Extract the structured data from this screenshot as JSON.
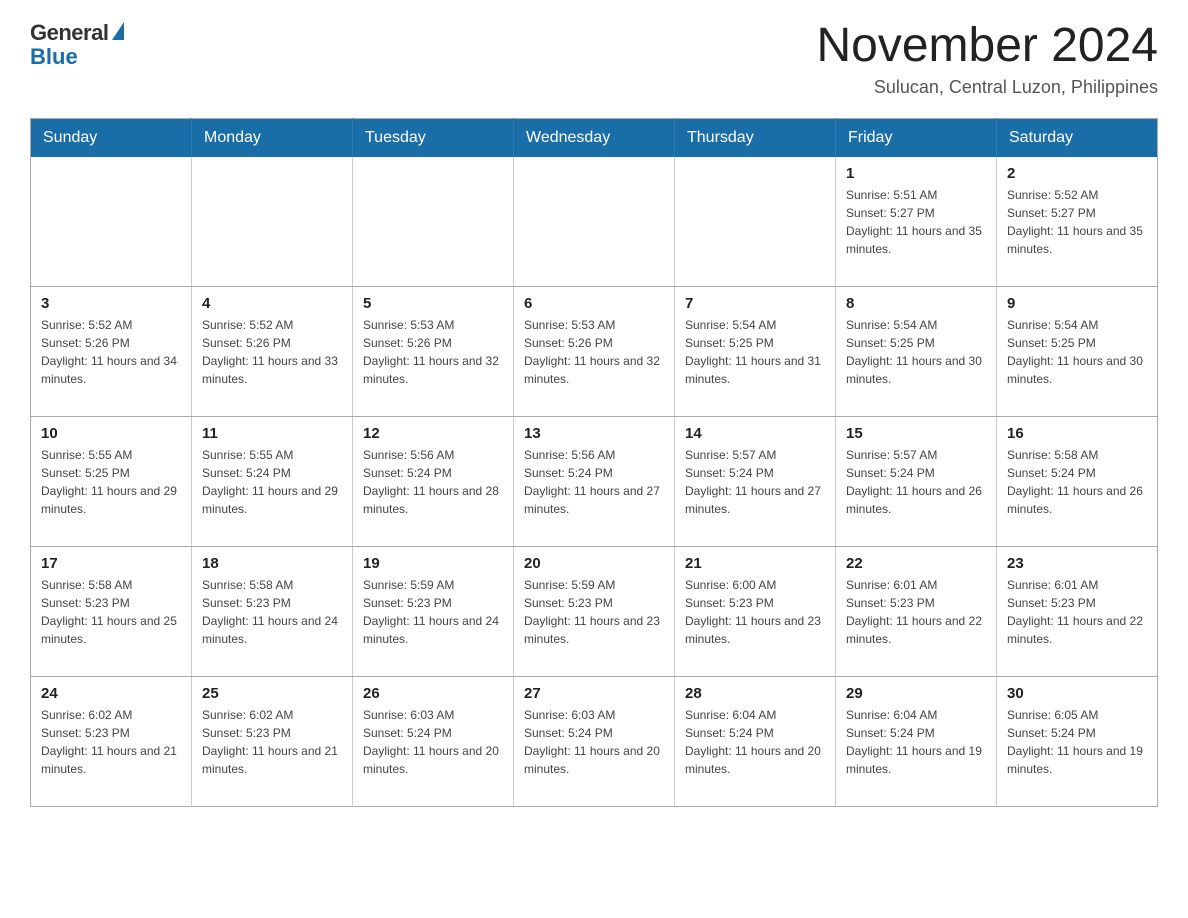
{
  "logo": {
    "general": "General",
    "blue": "Blue"
  },
  "title": "November 2024",
  "subtitle": "Sulucan, Central Luzon, Philippines",
  "weekdays": [
    "Sunday",
    "Monday",
    "Tuesday",
    "Wednesday",
    "Thursday",
    "Friday",
    "Saturday"
  ],
  "weeks": [
    [
      {
        "day": "",
        "info": ""
      },
      {
        "day": "",
        "info": ""
      },
      {
        "day": "",
        "info": ""
      },
      {
        "day": "",
        "info": ""
      },
      {
        "day": "",
        "info": ""
      },
      {
        "day": "1",
        "info": "Sunrise: 5:51 AM\nSunset: 5:27 PM\nDaylight: 11 hours and 35 minutes."
      },
      {
        "day": "2",
        "info": "Sunrise: 5:52 AM\nSunset: 5:27 PM\nDaylight: 11 hours and 35 minutes."
      }
    ],
    [
      {
        "day": "3",
        "info": "Sunrise: 5:52 AM\nSunset: 5:26 PM\nDaylight: 11 hours and 34 minutes."
      },
      {
        "day": "4",
        "info": "Sunrise: 5:52 AM\nSunset: 5:26 PM\nDaylight: 11 hours and 33 minutes."
      },
      {
        "day": "5",
        "info": "Sunrise: 5:53 AM\nSunset: 5:26 PM\nDaylight: 11 hours and 32 minutes."
      },
      {
        "day": "6",
        "info": "Sunrise: 5:53 AM\nSunset: 5:26 PM\nDaylight: 11 hours and 32 minutes."
      },
      {
        "day": "7",
        "info": "Sunrise: 5:54 AM\nSunset: 5:25 PM\nDaylight: 11 hours and 31 minutes."
      },
      {
        "day": "8",
        "info": "Sunrise: 5:54 AM\nSunset: 5:25 PM\nDaylight: 11 hours and 30 minutes."
      },
      {
        "day": "9",
        "info": "Sunrise: 5:54 AM\nSunset: 5:25 PM\nDaylight: 11 hours and 30 minutes."
      }
    ],
    [
      {
        "day": "10",
        "info": "Sunrise: 5:55 AM\nSunset: 5:25 PM\nDaylight: 11 hours and 29 minutes."
      },
      {
        "day": "11",
        "info": "Sunrise: 5:55 AM\nSunset: 5:24 PM\nDaylight: 11 hours and 29 minutes."
      },
      {
        "day": "12",
        "info": "Sunrise: 5:56 AM\nSunset: 5:24 PM\nDaylight: 11 hours and 28 minutes."
      },
      {
        "day": "13",
        "info": "Sunrise: 5:56 AM\nSunset: 5:24 PM\nDaylight: 11 hours and 27 minutes."
      },
      {
        "day": "14",
        "info": "Sunrise: 5:57 AM\nSunset: 5:24 PM\nDaylight: 11 hours and 27 minutes."
      },
      {
        "day": "15",
        "info": "Sunrise: 5:57 AM\nSunset: 5:24 PM\nDaylight: 11 hours and 26 minutes."
      },
      {
        "day": "16",
        "info": "Sunrise: 5:58 AM\nSunset: 5:24 PM\nDaylight: 11 hours and 26 minutes."
      }
    ],
    [
      {
        "day": "17",
        "info": "Sunrise: 5:58 AM\nSunset: 5:23 PM\nDaylight: 11 hours and 25 minutes."
      },
      {
        "day": "18",
        "info": "Sunrise: 5:58 AM\nSunset: 5:23 PM\nDaylight: 11 hours and 24 minutes."
      },
      {
        "day": "19",
        "info": "Sunrise: 5:59 AM\nSunset: 5:23 PM\nDaylight: 11 hours and 24 minutes."
      },
      {
        "day": "20",
        "info": "Sunrise: 5:59 AM\nSunset: 5:23 PM\nDaylight: 11 hours and 23 minutes."
      },
      {
        "day": "21",
        "info": "Sunrise: 6:00 AM\nSunset: 5:23 PM\nDaylight: 11 hours and 23 minutes."
      },
      {
        "day": "22",
        "info": "Sunrise: 6:01 AM\nSunset: 5:23 PM\nDaylight: 11 hours and 22 minutes."
      },
      {
        "day": "23",
        "info": "Sunrise: 6:01 AM\nSunset: 5:23 PM\nDaylight: 11 hours and 22 minutes."
      }
    ],
    [
      {
        "day": "24",
        "info": "Sunrise: 6:02 AM\nSunset: 5:23 PM\nDaylight: 11 hours and 21 minutes."
      },
      {
        "day": "25",
        "info": "Sunrise: 6:02 AM\nSunset: 5:23 PM\nDaylight: 11 hours and 21 minutes."
      },
      {
        "day": "26",
        "info": "Sunrise: 6:03 AM\nSunset: 5:24 PM\nDaylight: 11 hours and 20 minutes."
      },
      {
        "day": "27",
        "info": "Sunrise: 6:03 AM\nSunset: 5:24 PM\nDaylight: 11 hours and 20 minutes."
      },
      {
        "day": "28",
        "info": "Sunrise: 6:04 AM\nSunset: 5:24 PM\nDaylight: 11 hours and 20 minutes."
      },
      {
        "day": "29",
        "info": "Sunrise: 6:04 AM\nSunset: 5:24 PM\nDaylight: 11 hours and 19 minutes."
      },
      {
        "day": "30",
        "info": "Sunrise: 6:05 AM\nSunset: 5:24 PM\nDaylight: 11 hours and 19 minutes."
      }
    ]
  ]
}
